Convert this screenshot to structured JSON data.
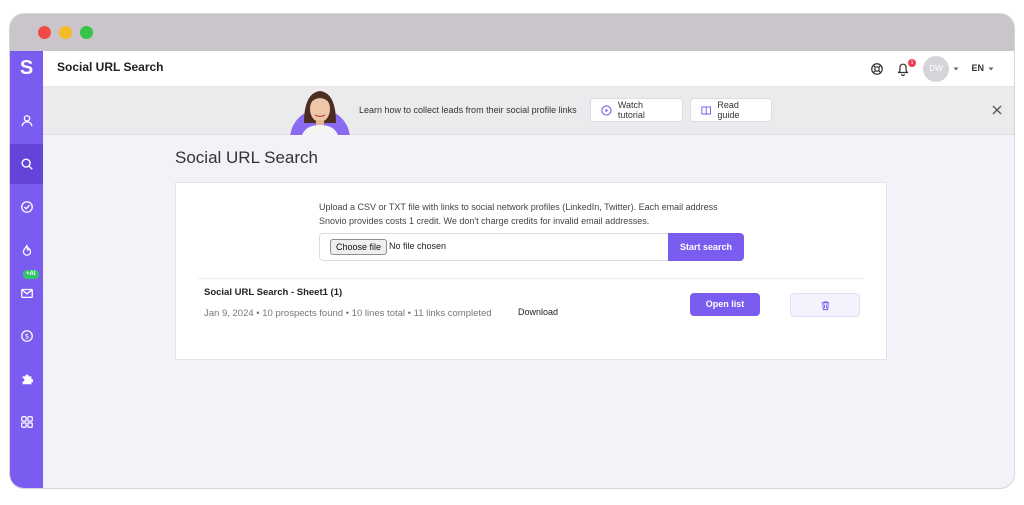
{
  "app": {
    "logo_letter": "S",
    "page_header": "Social URL Search"
  },
  "sidebar": {
    "ai_badge": "+AI",
    "items": [
      {
        "name": "prospects",
        "icon": "user-icon"
      },
      {
        "name": "search",
        "icon": "search-icon",
        "active": true
      },
      {
        "name": "verify",
        "icon": "check-circle-icon"
      },
      {
        "name": "warmup",
        "icon": "flame-icon"
      },
      {
        "name": "campaigns",
        "icon": "mail-icon"
      },
      {
        "name": "billing",
        "icon": "dollar-icon"
      },
      {
        "name": "integrations",
        "icon": "puzzle-icon"
      },
      {
        "name": "apps",
        "icon": "grid-icon"
      }
    ]
  },
  "topbar": {
    "notification_count": "1",
    "avatar_initials": "DW",
    "language": "EN"
  },
  "banner": {
    "text": "Learn how to collect leads from their social profile links",
    "watch_label": "Watch tutorial",
    "read_label": "Read guide"
  },
  "main": {
    "title": "Social URL Search",
    "description_line1": "Upload a CSV or TXT file with links to social network profiles (LinkedIn, Twitter). Each email address",
    "description_line2": "Snovio provides costs 1 credit. We don't charge credits for invalid email addresses.",
    "choose_file_label": "Choose file",
    "no_file_text": "No file chosen",
    "start_search_label": "Start search",
    "result": {
      "title": "Social URL Search - Sheet1 (1)",
      "meta": "Jan 9, 2024 • 10 prospects found • 10 lines total • 11 links completed",
      "download_label": "Download",
      "open_list_label": "Open list"
    }
  },
  "colors": {
    "accent": "#7b5cf0",
    "sidebar_active": "#6444d8",
    "badge_green": "#2fc46a",
    "notification_red": "#ef3b55"
  }
}
